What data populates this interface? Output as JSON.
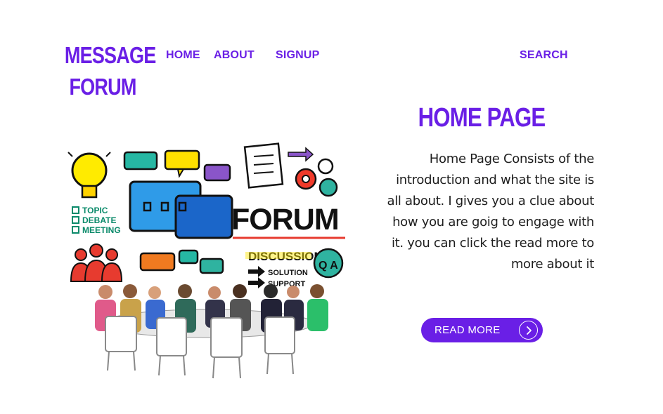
{
  "logo": {
    "line1": "MESSAGE",
    "line2": "FORUM"
  },
  "nav": {
    "home": "HOME",
    "about": "ABOUT",
    "signup": "SIGNUP",
    "search": "SEARCH"
  },
  "hero": {
    "forum_word": "FORUM",
    "discussion": "DISCUSSION",
    "solution": "SOLUTION",
    "support": "SUPPORT",
    "checklist": [
      "TOPIC",
      "DEBATE",
      "MEETING"
    ],
    "qa": "Q A"
  },
  "main": {
    "title": "HOME PAGE",
    "intro_lines": [
      "Home Page Consists of the",
      "introduction and what the site is",
      "all about. I gives you a clue about",
      "how you are goig to engage with",
      "it. you can click the  read more to",
      "more about it "
    ],
    "read_more_label": "READ MORE"
  },
  "colors": {
    "accent": "#6a1fe6",
    "text": "#1e1e1e",
    "background": "#ffffff"
  }
}
